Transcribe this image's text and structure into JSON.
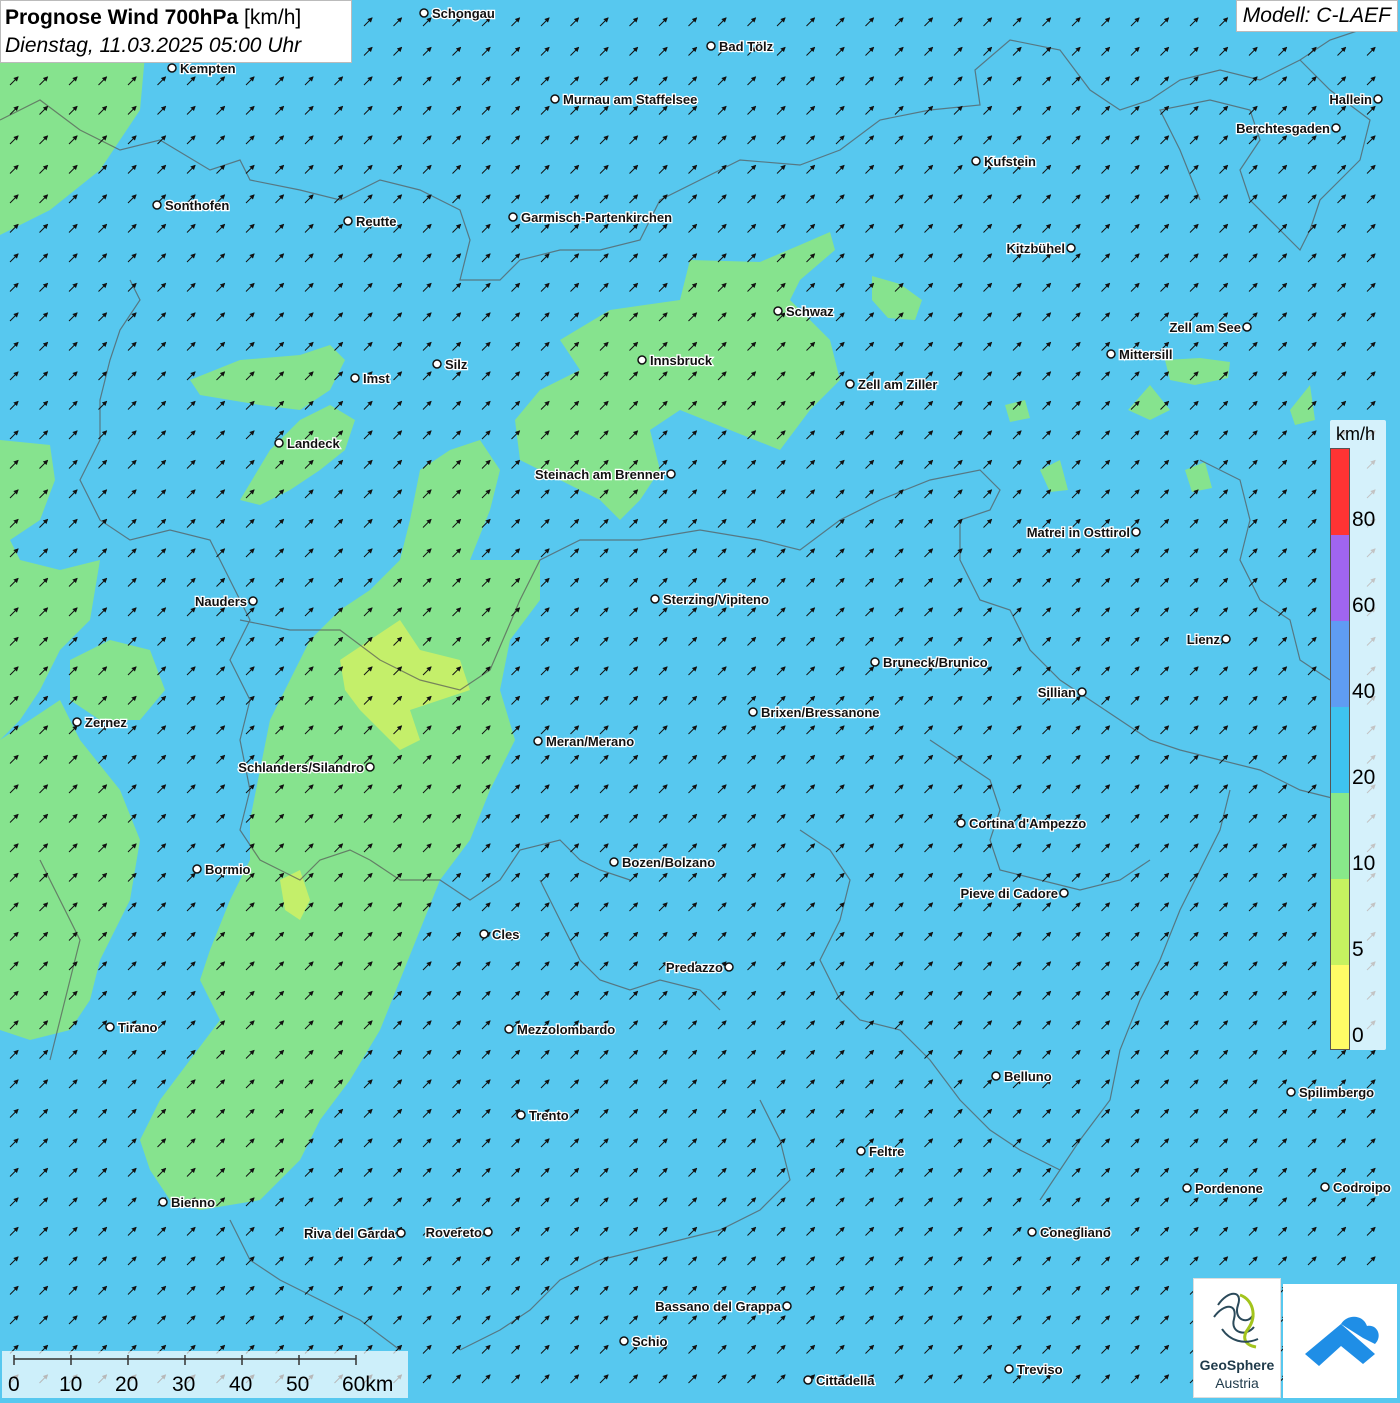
{
  "title": {
    "bold": "Prognose Wind 700hPa",
    "unit": "[km/h]",
    "datetime": "Dienstag, 11.03.2025 05:00 Uhr"
  },
  "model": "Modell: C-LAEF",
  "legend": {
    "unit": "km/h",
    "labels": [
      "80",
      "60",
      "40",
      "20",
      "10",
      "5",
      "0"
    ],
    "colors": [
      "#ff3333",
      "#a065ef",
      "#5f9cf3",
      "#3ec3ef",
      "#88e88a",
      "#c6f260",
      "#fffb66"
    ]
  },
  "scale_bar": {
    "labels": [
      "0",
      "10",
      "20",
      "30",
      "40",
      "50",
      "60km"
    ]
  },
  "logos": {
    "geosphere_line1": "GeoSphere",
    "geosphere_line2": "Austria"
  },
  "cities": [
    {
      "name": "Schongau"
    },
    {
      "name": "Bad Tölz"
    },
    {
      "name": "Kempten"
    },
    {
      "name": "Murnau am Staffelsee"
    },
    {
      "name": "Hallein"
    },
    {
      "name": "Berchtesgaden"
    },
    {
      "name": "Kufstein"
    },
    {
      "name": "Sonthofen"
    },
    {
      "name": "Reutte"
    },
    {
      "name": "Garmisch-Partenkirchen"
    },
    {
      "name": "Kitzbühel"
    },
    {
      "name": "Schwaz"
    },
    {
      "name": "Zell am See"
    },
    {
      "name": "Mittersill"
    },
    {
      "name": "Innsbruck"
    },
    {
      "name": "Silz"
    },
    {
      "name": "Imst"
    },
    {
      "name": "Zell am Ziller"
    },
    {
      "name": "Landeck"
    },
    {
      "name": "Steinach am Brenner"
    },
    {
      "name": "Matrei in Osttirol"
    },
    {
      "name": "Nauders"
    },
    {
      "name": "Sterzing/Vipiteno"
    },
    {
      "name": "Lienz"
    },
    {
      "name": "Bruneck/Brunico"
    },
    {
      "name": "Sillian"
    },
    {
      "name": "Brixen/Bressanone"
    },
    {
      "name": "Zernez"
    },
    {
      "name": "Meran/Merano"
    },
    {
      "name": "Schlanders/Silandro"
    },
    {
      "name": "Cortina d'Ampezzo"
    },
    {
      "name": "Bozen/Bolzano"
    },
    {
      "name": "Bormio"
    },
    {
      "name": "Pieve di Cadore"
    },
    {
      "name": "Cles"
    },
    {
      "name": "Predazzo"
    },
    {
      "name": "Tirano"
    },
    {
      "name": "Mezzolombardo"
    },
    {
      "name": "Belluno"
    },
    {
      "name": "Spilimbergo"
    },
    {
      "name": "Trento"
    },
    {
      "name": "Feltre"
    },
    {
      "name": "Pordenone"
    },
    {
      "name": "Codroipo"
    },
    {
      "name": "Bienno"
    },
    {
      "name": "Riva del Garda"
    },
    {
      "name": "Rovereto"
    },
    {
      "name": "Conegliano"
    },
    {
      "name": "Bassano del Grappa"
    },
    {
      "name": "Schio"
    },
    {
      "name": "Treviso"
    },
    {
      "name": "Cittadella"
    }
  ]
}
